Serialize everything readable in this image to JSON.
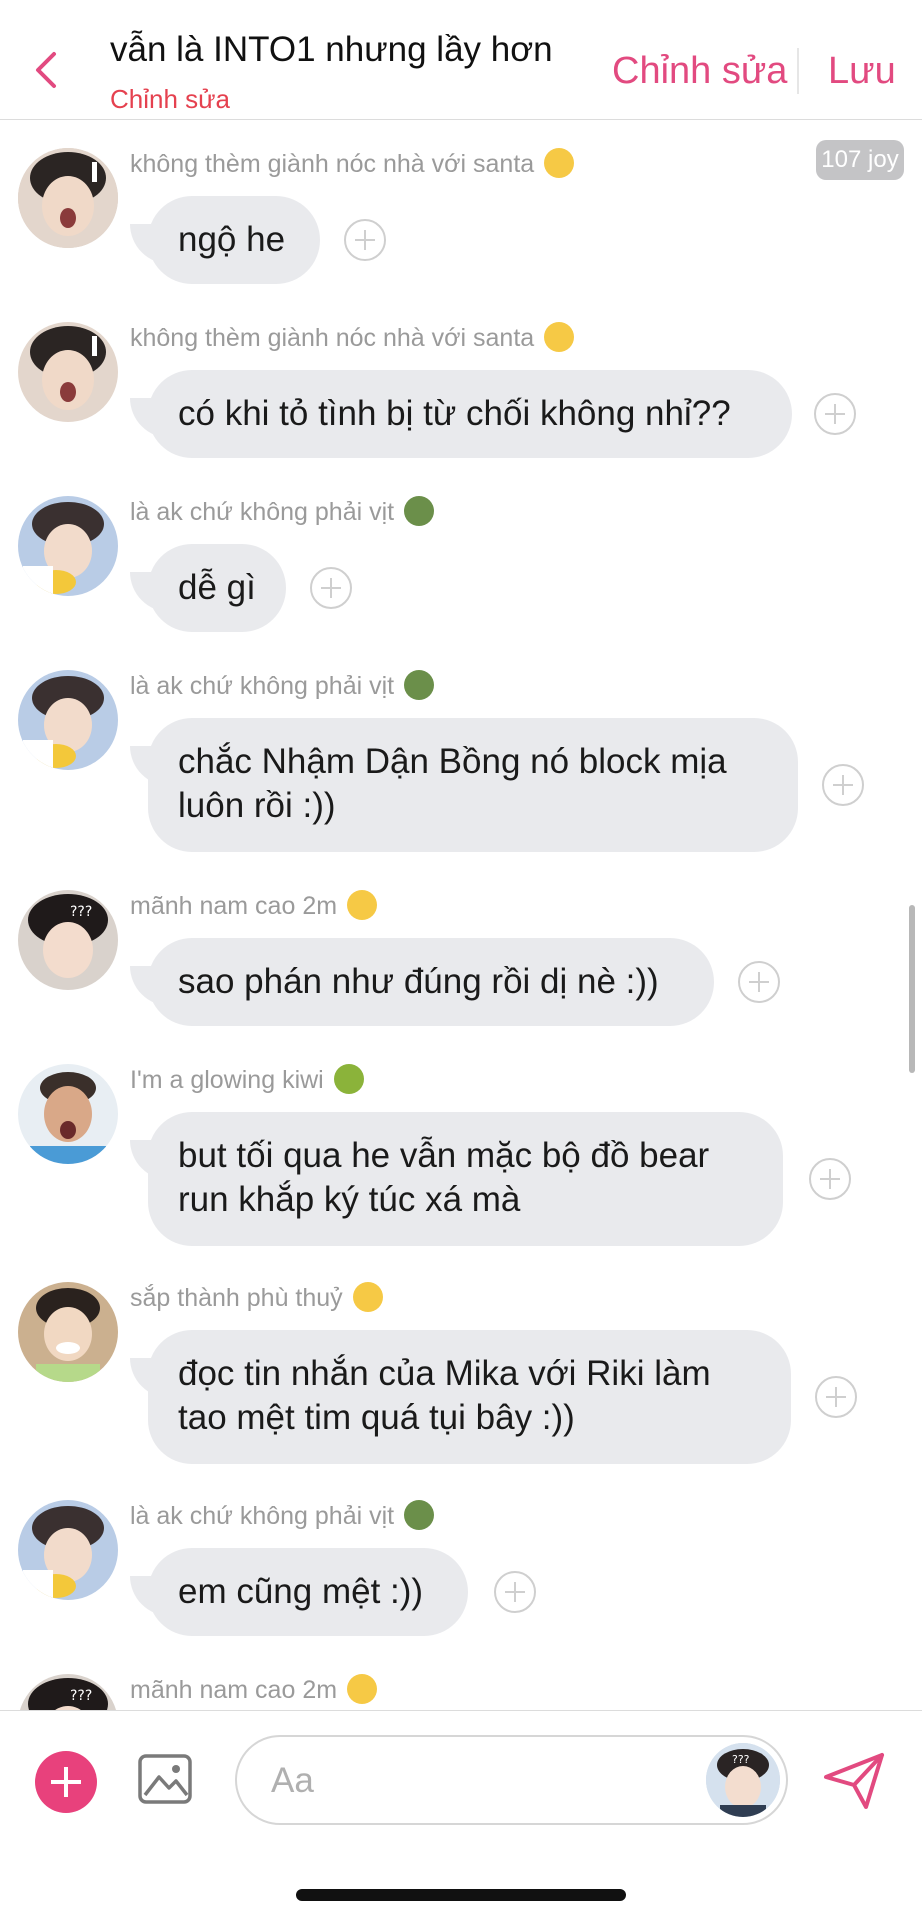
{
  "header": {
    "title": "vẫn là INTO1 nhưng lầy hơn",
    "subtitle": "Chỉnh sửa",
    "edit_label": "Chỉnh sửa",
    "save_label": "Lưu"
  },
  "badge": {
    "label": "107 joy"
  },
  "messages": [
    {
      "sender": "không thèm giành nóc nhà với santa",
      "emoji": "frowning-face-emoji",
      "text": "ngộ he"
    },
    {
      "sender": "không thèm giành nóc nhà với santa",
      "emoji": "frowning-face-emoji",
      "text": "có khi tỏ tình bị từ chối không nhỉ??"
    },
    {
      "sender": "là ak chứ không phải vịt",
      "emoji": "duck-emoji",
      "text": "dễ gì"
    },
    {
      "sender": "là ak chứ không phải vịt",
      "emoji": "duck-emoji",
      "text": "chắc Nhậm Dận Bồng nó block mịa\nluôn rồi :))"
    },
    {
      "sender": "mãnh nam cao 2m",
      "emoji": "grinning-face-emoji",
      "text": "sao phán như đúng rồi dị nè :))"
    },
    {
      "sender": "I'm a glowing kiwi",
      "emoji": "kiwi-emoji",
      "text": "but tối qua he vẫn mặc bộ đồ bear\nrun khắp ký túc xá mà"
    },
    {
      "sender": "sắp thành phù thuỷ",
      "emoji": "crying-face-emoji",
      "text": "đọc tin nhắn của Mika với Riki   làm\ntao mệt tim quá tụi bây :))"
    },
    {
      "sender": "là ak chứ không phải vịt",
      "emoji": "duck-emoji",
      "text": "em cũng mệt :))"
    },
    {
      "sender": "mãnh nam cao 2m",
      "emoji": "grinning-face-emoji",
      "text": ""
    }
  ],
  "composer": {
    "placeholder": "Aa"
  },
  "colors": {
    "accent": "#e24a80",
    "subtitle_red": "#e5414f",
    "bubble": "#e9eaed"
  }
}
